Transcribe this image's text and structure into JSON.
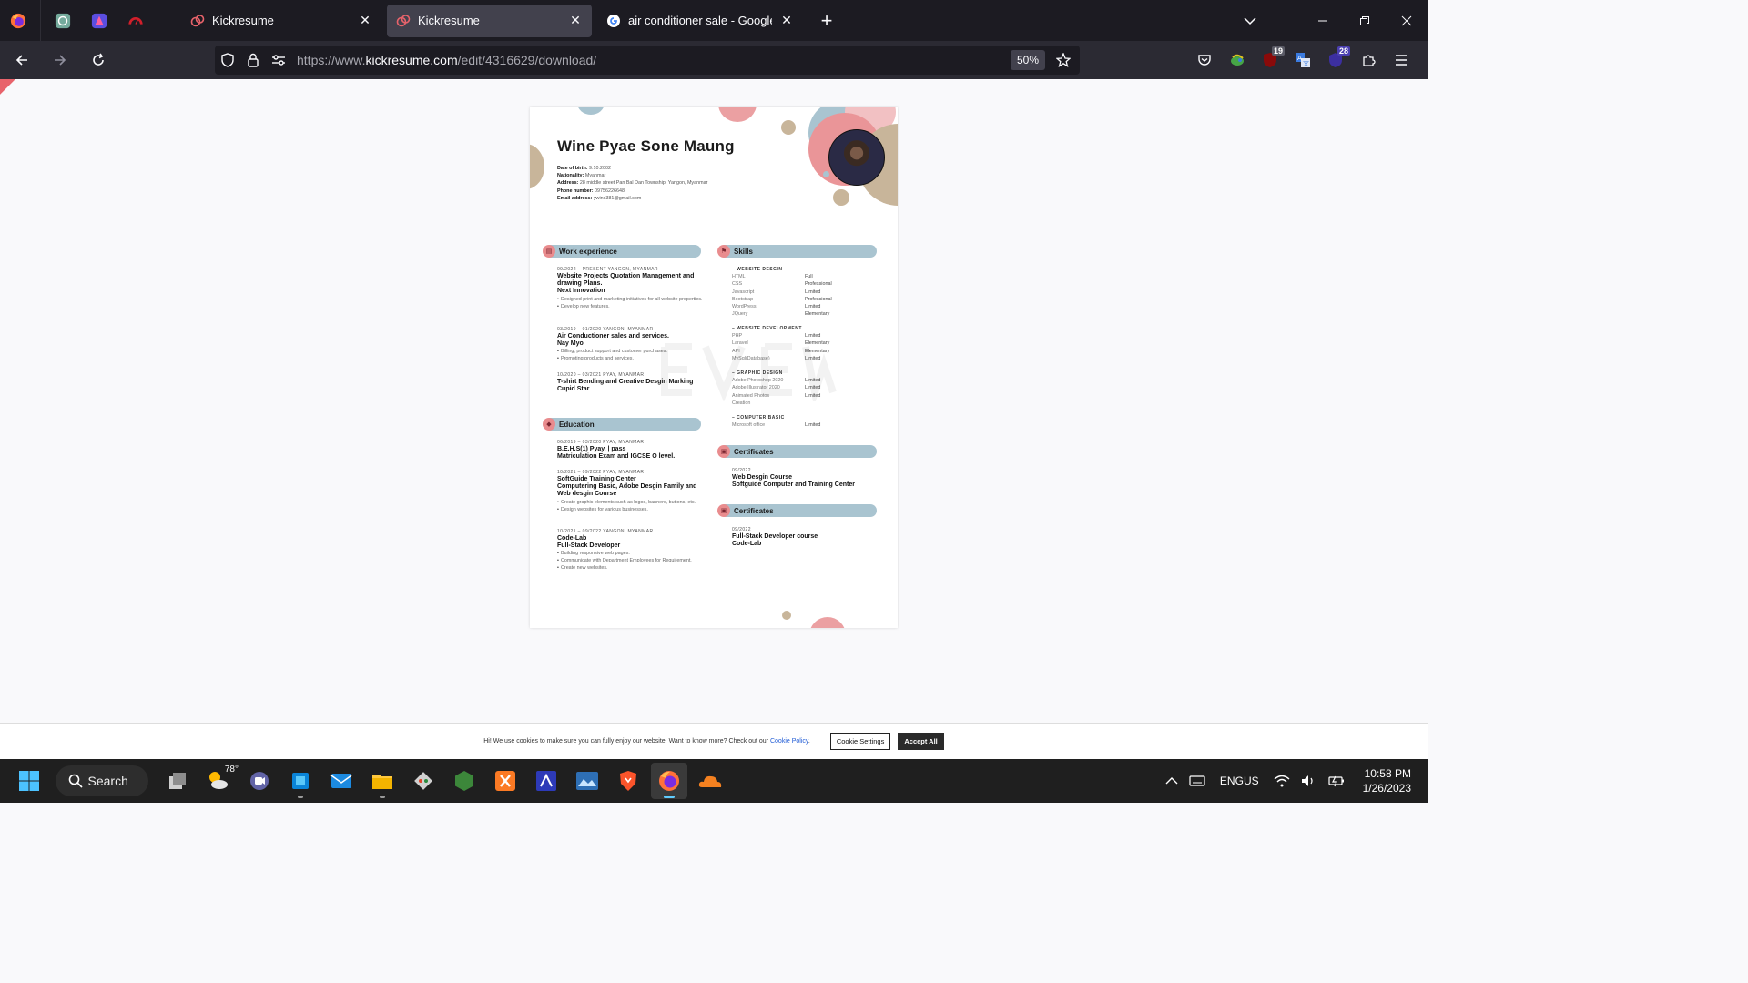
{
  "browser": {
    "tabs": [
      {
        "title": "Kickresume",
        "active": false
      },
      {
        "title": "Kickresume",
        "active": true
      },
      {
        "title": "air conditioner sale - Google Se",
        "active": false
      }
    ],
    "url_prefix": "https://www.",
    "url_domain": "kickresume.com",
    "url_path": "/edit/4316629/download/",
    "zoom": "50%",
    "badges": {
      "ublock": "19",
      "ext28": "28"
    }
  },
  "resume": {
    "name": "Wine Pyae Sone Maung",
    "info": [
      {
        "label": "Date of birth:",
        "value": "9.10.2002"
      },
      {
        "label": "Nationality:",
        "value": "Myanmar"
      },
      {
        "label": "Address:",
        "value": "28 middle street Pan Bal Dan Township, Yangon, Myanmar"
      },
      {
        "label": "Phone number:",
        "value": "09756226648"
      },
      {
        "label": "Email address:",
        "value": "ywinc381@gmail.com"
      }
    ],
    "sections": {
      "work": "Work experience",
      "education": "Education",
      "skills": "Skills",
      "cert1": "Certificates",
      "cert2": "Certificates"
    },
    "work": [
      {
        "meta": "09/2022 – PRESENT     YANGON, MYANMAR",
        "title": "Website Projects Quotation Management and drawing Plans.",
        "sub": "Next Innovation",
        "bullets": [
          "Designed print and marketing initiatives for all website properties.",
          "Develop new features."
        ]
      },
      {
        "meta": "03/2019 – 01/2020     YANGON, MYANMAR",
        "title": "Air Conductioner sales and services.",
        "sub": "Nay Myo",
        "bullets": [
          "Billing, product support and customer purchases.",
          "Promoting products and services."
        ]
      },
      {
        "meta": "10/2020 – 03/2021     PYAY, MYANMAR",
        "title": "T-shirt Bending and Creative Desgin Marking",
        "sub": "Cupid Star",
        "bullets": []
      }
    ],
    "education": [
      {
        "meta": "06/2019 – 03/2020     PYAY, MYANMAR",
        "title": "B.E.H.S(1) Pyay. | pass",
        "sub": "Matriculation Exam and IGCSE O level.",
        "bullets": []
      },
      {
        "meta": "10/2021 – 09/2022     PYAY, MYANMAR",
        "title": "SoftGuide Training Center",
        "sub": "Computering Basic, Adobe Desgin Family and Web desgin Course",
        "bullets": [
          "Create graphic elements such as logos, banners, buttons, etc.",
          "Design websites for various businesses."
        ]
      },
      {
        "meta": "10/2021 – 09/2022     YANGON, MYANMAR",
        "title": "Code-Lab",
        "sub": "Full-Stack Developer",
        "bullets": [
          "Building responsive web pages.",
          "Communicate with Department Employees for Requirement.",
          "Create new websites."
        ]
      }
    ],
    "skills": [
      {
        "group": "– WEBSITE DESGIN",
        "items": [
          [
            "HTML",
            "Full"
          ],
          [
            "CSS",
            "Professional"
          ],
          [
            "Javascript",
            "Limited"
          ],
          [
            "Bootstrap",
            "Professional"
          ],
          [
            "WordPress",
            "Limited"
          ],
          [
            "JQuery",
            "Elementary"
          ]
        ]
      },
      {
        "group": "– WEBSITE DEVELOPMENT",
        "items": [
          [
            "PHP",
            "Limited"
          ],
          [
            "Laravel",
            "Elementary"
          ],
          [
            "API",
            "Elementary"
          ],
          [
            "MySql(Database)",
            "Limited"
          ]
        ]
      },
      {
        "group": "– GRAPHIC DESIGN",
        "items": [
          [
            "Adobe Photoshop 2020",
            "Limited"
          ],
          [
            "Adobe Illustrator 2020",
            "Limited"
          ],
          [
            "Animated Photos Creation",
            "Limited"
          ]
        ]
      },
      {
        "group": "– COMPUTER BASIC",
        "items": [
          [
            "Microsoft office",
            "Limited"
          ]
        ]
      }
    ],
    "certs": [
      {
        "meta": "09/2022",
        "title": "Web Desgin Course",
        "sub": "Softguide Computer and Training Center"
      },
      {
        "meta": "09/2022",
        "title": "Full-Stack Developer course",
        "sub": "Code-Lab"
      }
    ]
  },
  "cookie": {
    "text": "Hi! We use cookies to make sure you can fully enjoy our website. Want to know more? Check out our ",
    "link": "Cookie Policy",
    "after": ".",
    "settings": "Cookie Settings",
    "accept": "Accept All"
  },
  "taskbar": {
    "search": "Search",
    "weather": "78°",
    "lang_top": "ENG",
    "lang_bottom": "US",
    "time": "10:58 PM",
    "date": "1/26/2023"
  },
  "colors": {
    "accent_pink": "#e98c8e",
    "accent_blue": "#a9c4d0",
    "accent_tan": "#c8b59a"
  }
}
